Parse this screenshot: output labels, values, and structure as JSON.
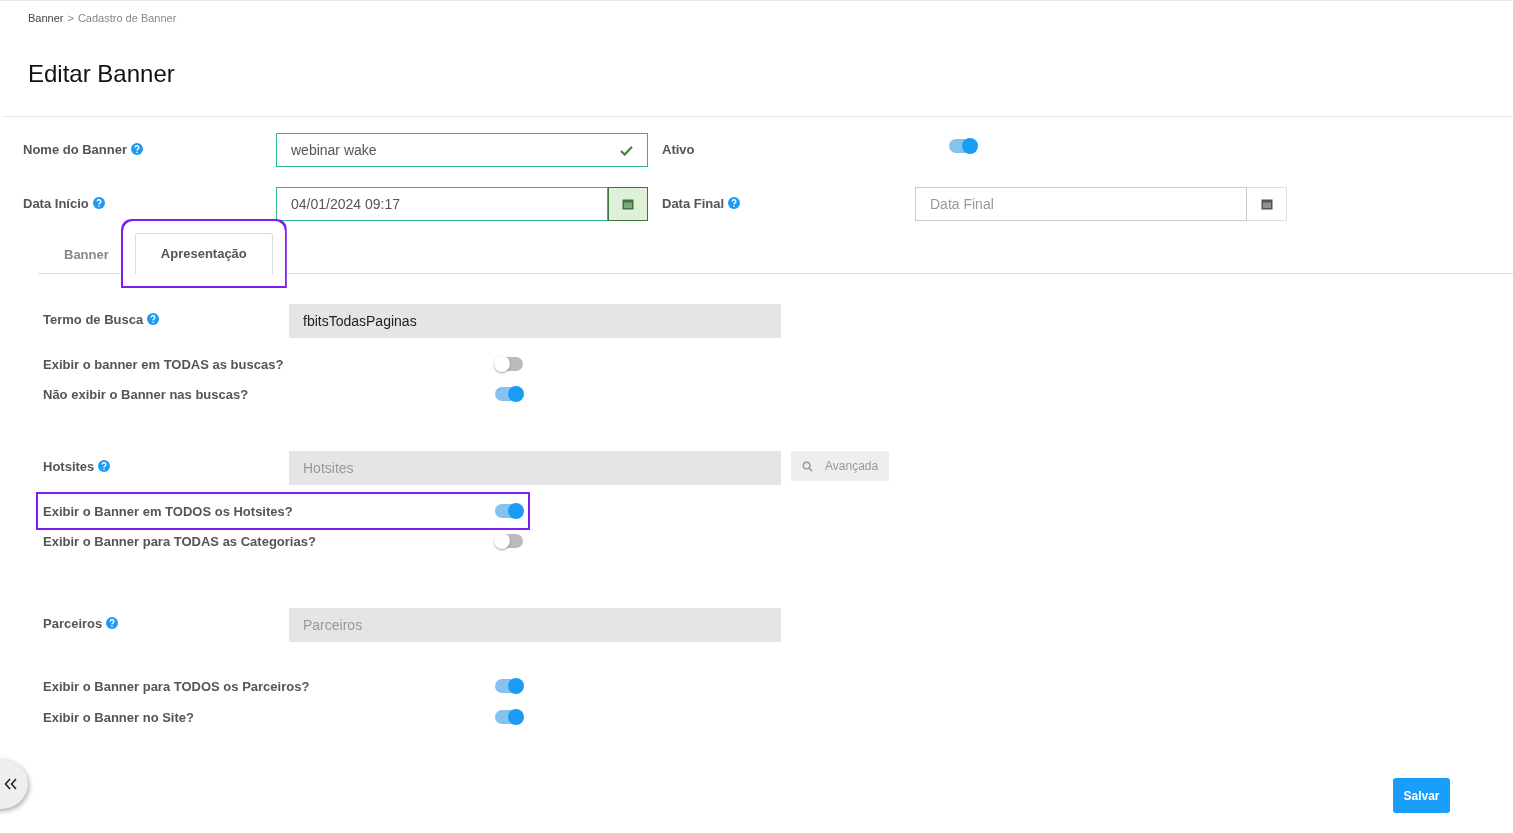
{
  "breadcrumb": [
    {
      "label": "Banner",
      "current": false
    },
    {
      "label": "Cadastro de Banner",
      "current": true
    }
  ],
  "breadcrumb_separator": ">",
  "title": "Editar Banner",
  "top_fields": [
    {
      "label": "Nome do Banner",
      "help": true,
      "kind": "text",
      "value": "webinar wake",
      "valid": true,
      "side": {
        "label": "Ativo",
        "help": false,
        "kind": "toggle",
        "on": true
      }
    },
    {
      "label": "Data Início",
      "help": true,
      "kind": "date",
      "value": "04/01/2024 09:17",
      "valid": true,
      "side": {
        "label": "Data Final",
        "help": true,
        "kind": "date",
        "placeholder": "Data Final"
      }
    }
  ],
  "tabs": [
    {
      "label": "Banner",
      "selected": false,
      "highlighted": false
    },
    {
      "label": "Apresentação",
      "selected": true,
      "highlighted": true
    }
  ],
  "groups": [
    {
      "label": "Termo de Busca",
      "help": true,
      "value": "fbitsTodasPaginas",
      "toggles": [
        {
          "label": "Exibir o banner em TODAS as buscas?",
          "on": false,
          "highlighted": false
        },
        {
          "label": "Não exibir o Banner nas buscas?",
          "on": true,
          "highlighted": false
        }
      ]
    },
    {
      "label": "Hotsites",
      "help": true,
      "placeholder": "Hotsites",
      "button": "Avançada",
      "toggles": [
        {
          "label": "Exibir o Banner em TODOS os Hotsites?",
          "on": true,
          "highlighted": true
        },
        {
          "label": "Exibir o Banner para TODAS as Categorias?",
          "on": false,
          "highlighted": false
        }
      ]
    },
    {
      "label": "Parceiros",
      "help": true,
      "placeholder": "Parceiros",
      "toggles": [
        {
          "label": "Exibir o Banner para TODOS os Parceiros?",
          "on": true,
          "highlighted": false
        },
        {
          "label": "Exibir o Banner no Site?",
          "on": true,
          "highlighted": false
        }
      ]
    }
  ],
  "save_button": "Salvar"
}
